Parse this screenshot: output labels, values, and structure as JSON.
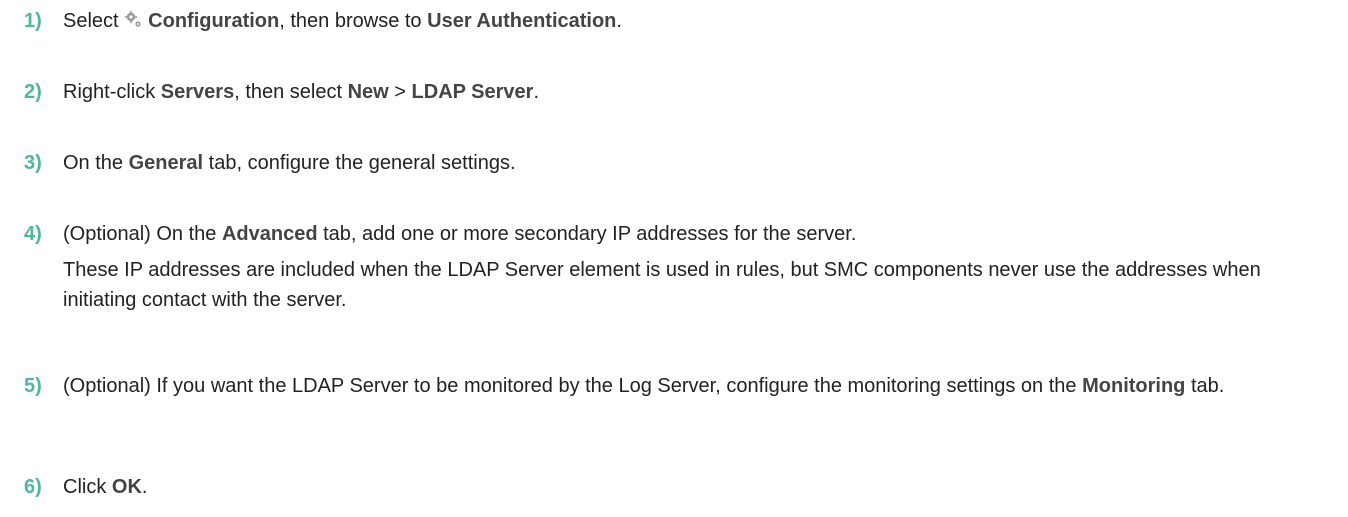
{
  "steps": [
    {
      "num": "1)",
      "parts": [
        "Select ",
        "Configuration",
        ", then browse to ",
        "User Authentication",
        "."
      ],
      "icon": "gear-icon"
    },
    {
      "num": "2)",
      "parts": [
        "Right-click ",
        "Servers",
        ", then select ",
        "New",
        " > ",
        "LDAP Server",
        "."
      ]
    },
    {
      "num": "3)",
      "parts": [
        "On the ",
        "General",
        " tab, configure the general settings."
      ]
    },
    {
      "num": "4)",
      "parts": [
        "(Optional) On the ",
        "Advanced",
        " tab, add one or more secondary IP addresses for the server."
      ],
      "note": "These IP addresses are included when the LDAP Server element is used in rules, but SMC components never use the addresses when initiating contact with the server."
    },
    {
      "num": "5)",
      "parts": [
        "(Optional) If you want the LDAP Server to be monitored by the Log Server, configure the monitoring settings on the ",
        "Monitoring",
        " tab."
      ]
    },
    {
      "num": "6)",
      "parts": [
        "Click ",
        "OK",
        "."
      ]
    }
  ],
  "colors": {
    "step_number": "#4fb6a0",
    "text": "#222222",
    "bold": "#444444",
    "icon": "#9a9a9a"
  }
}
